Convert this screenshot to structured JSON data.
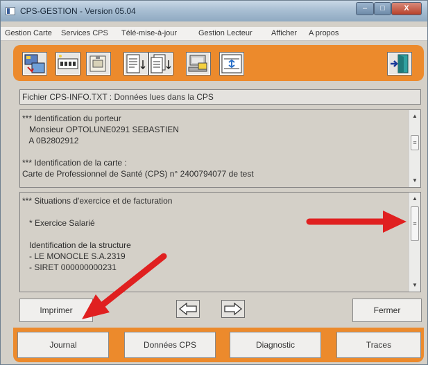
{
  "window": {
    "title": "CPS-GESTION - Version 05.04",
    "controls": {
      "minimize": "–",
      "maximize": "□",
      "close": "X"
    }
  },
  "menu": {
    "items": [
      "Gestion Carte",
      "Services CPS",
      "Télé-mise-à-jour",
      "Gestion Lecteur",
      "Afficher",
      "A propos"
    ]
  },
  "toolbar": {
    "icons": [
      "read-card-icon",
      "pin-code-icon",
      "card-insert-icon",
      "document-down-icon",
      "documents-down-icon",
      "computer-card-icon",
      "transfer-icon",
      "exit-door-icon"
    ]
  },
  "content": {
    "file_label": "Fichier CPS-INFO.TXT : Données lues dans la CPS",
    "box1_lines": [
      "*** Identification du porteur",
      "   Monsieur OPTOLUNE0291 SEBASTIEN",
      "   A 0B2802912",
      "",
      "*** Identification de la carte :",
      "Carte de Professionnel de Santé (CPS) n° 2400794077 de test"
    ],
    "box2_lines": [
      "*** Situations d'exercice et de facturation",
      "",
      "   * Exercice Salarié",
      "",
      "   Identification de la structure",
      "   - LE MONOCLE S.A.2319",
      "   - SIRET 000000000231"
    ]
  },
  "buttons": {
    "print": "Imprimer",
    "close": "Fermer",
    "prev_glyph": "⇦",
    "next_glyph": "⇨"
  },
  "bottom": {
    "journal": "Journal",
    "donnees": "Données CPS",
    "diagnostic": "Diagnostic",
    "traces": "Traces"
  },
  "colors": {
    "accent_orange": "#ec8a2c",
    "annotation_red": "#e02020",
    "panel_gray": "#d4d0c8"
  }
}
